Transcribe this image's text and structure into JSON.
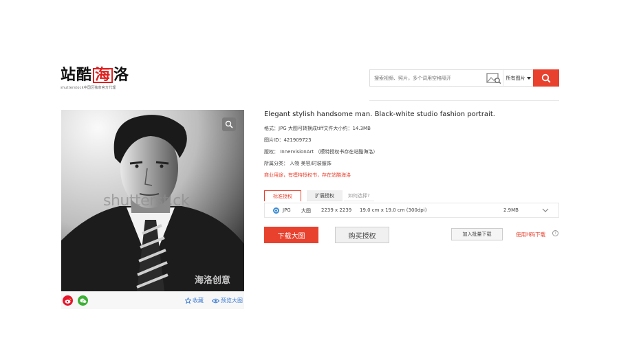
{
  "header": {
    "logo_text_a": "站酷",
    "logo_text_hai": "海",
    "logo_text_b": "洛",
    "logo_sub": "shutterstock中国区独家官方代理"
  },
  "search": {
    "placeholder": "搜索视频、照片，多个词用空格隔开",
    "filter_label": "所有图片"
  },
  "image": {
    "watermark_main": "shutterst.ck",
    "watermark_cn": "海洛创意",
    "favorite_label": "收藏",
    "preview_label": "预览大图"
  },
  "info": {
    "title": "Elegant stylish handsome man. Black-white studio fashion portrait.",
    "format": "格式：JPG 大图可转换成tiff文件大小约：14.3MB",
    "image_id": "图片ID：421909723",
    "copyright": "版权： InnervisionArt （模特授权书存在站酷海洛）",
    "category": "所属分类： 人物 美容/时装服饰",
    "commercial_note": "商业用途，有模特授权书，存在站酷海洛"
  },
  "license": {
    "tabs": [
      "标准授权",
      "扩展授权",
      "如何选择?"
    ],
    "row": {
      "format": "JPG",
      "size_name": "大图",
      "pixels": "2239 x 2239",
      "print_size": "19.0 cm x 19.0 cm (300dpi)",
      "file_size": "2.9MB"
    }
  },
  "actions": {
    "download": "下载大图",
    "buy": "购买授权",
    "batch": "加入批量下载",
    "h_download": "使用H码下载",
    "help": "?"
  },
  "colors": {
    "accent": "#e8412e",
    "link": "#3a7bd5",
    "weibo": "#e6162d",
    "wechat": "#3cb034"
  }
}
